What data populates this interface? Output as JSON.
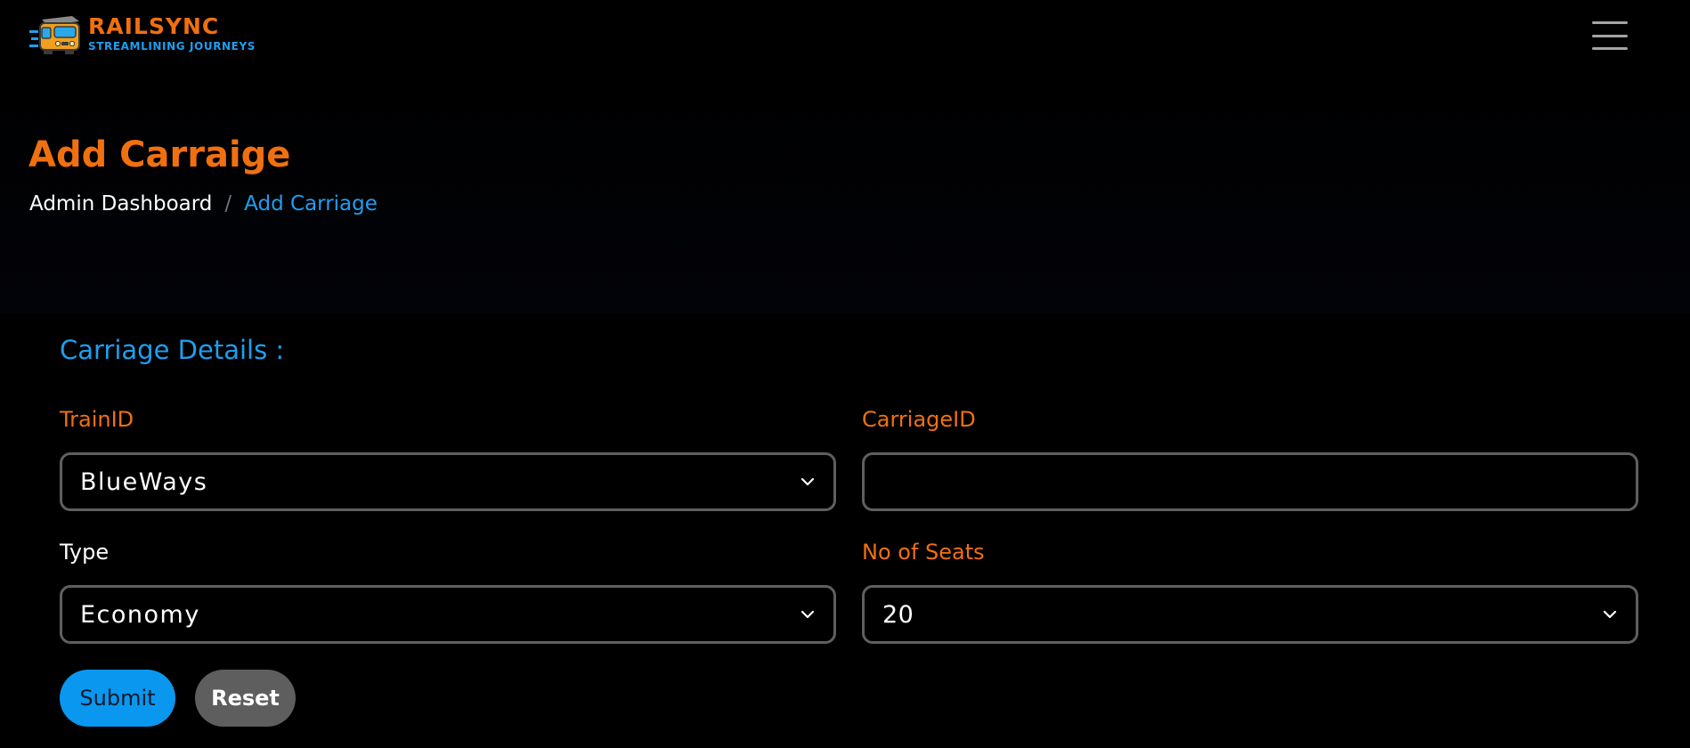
{
  "brand": {
    "name": "RAILSYNC",
    "tagline": "STREAMLINING JOURNEYS"
  },
  "page": {
    "title": "Add Carraige"
  },
  "breadcrumb": {
    "home": "Admin Dashboard",
    "separator": "/",
    "current": "Add Carriage"
  },
  "form": {
    "section_title": "Carriage Details :",
    "train": {
      "label": "TrainID",
      "value": "BlueWays"
    },
    "carriage": {
      "label": "CarriageID",
      "value": ""
    },
    "type": {
      "label": "Type",
      "value": "Economy"
    },
    "seats": {
      "label": "No of Seats",
      "value": "20"
    },
    "submit_label": "Submit",
    "reset_label": "Reset"
  },
  "colors": {
    "accent_orange": "#f0700f",
    "accent_blue": "#1e9ff0",
    "submit_blue": "#0a97f0",
    "reset_gray": "#5e5e5e"
  },
  "icons": [
    "train-logo-icon",
    "hamburger-menu-icon",
    "chevron-down-icon"
  ]
}
